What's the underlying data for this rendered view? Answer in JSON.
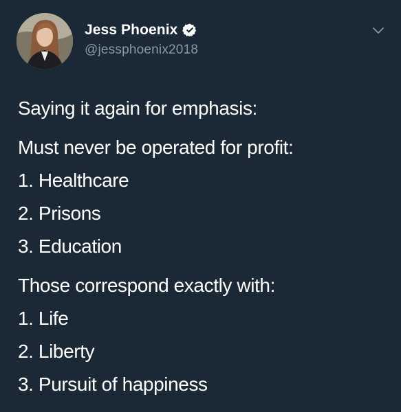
{
  "author": {
    "display_name": "Jess Phoenix",
    "handle": "@jessphoenix2018",
    "verified": true
  },
  "icons": {
    "avatar": "profile-photo",
    "verified": "verified-badge-icon",
    "menu": "chevron-down-icon"
  },
  "colors": {
    "background": "#1b2836",
    "text": "#ffffff",
    "handle": "#8899a6"
  },
  "tweet": {
    "intro": "Saying it again for emphasis:",
    "list1": {
      "heading": "Must never be operated for profit:",
      "items": [
        "1. Healthcare",
        "2. Prisons",
        "3. Education"
      ]
    },
    "list2": {
      "heading": "Those correspond exactly with:",
      "items": [
        "1. Life",
        "2. Liberty",
        "3. Pursuit of happiness"
      ]
    }
  }
}
